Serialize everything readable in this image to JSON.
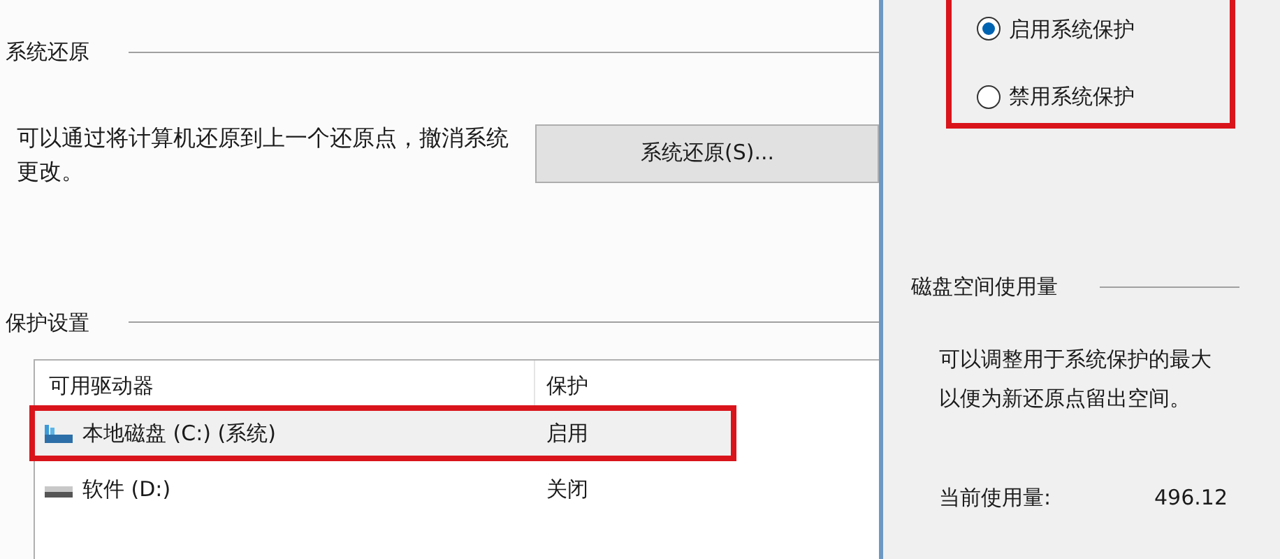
{
  "system_restore": {
    "heading": "系统还原",
    "description": "可以通过将计算机还原到上一个还原点，撤消系统更改。",
    "button": "系统还原(S)..."
  },
  "protection_settings": {
    "heading": "保护设置",
    "columns": [
      "可用驱动器",
      "保护"
    ],
    "rows": [
      {
        "drive": "本地磁盘 (C:) (系统)",
        "kind": "system",
        "protection": "启用",
        "highlighted": true
      },
      {
        "drive": "软件 (D:)",
        "kind": "data",
        "protection": "关闭",
        "highlighted": false
      }
    ]
  },
  "restore_settings": {
    "highlighted": true,
    "options": [
      {
        "label": "启用系统保护",
        "selected": true
      },
      {
        "label": "禁用系统保护",
        "selected": false
      }
    ]
  },
  "disk_usage": {
    "heading": "磁盘空间使用量",
    "description_lines": [
      "可以调整用于系统保护的最大",
      "以便为新还原点留出空间。"
    ],
    "current_label": "当前使用量:",
    "current_value": "496.12"
  }
}
